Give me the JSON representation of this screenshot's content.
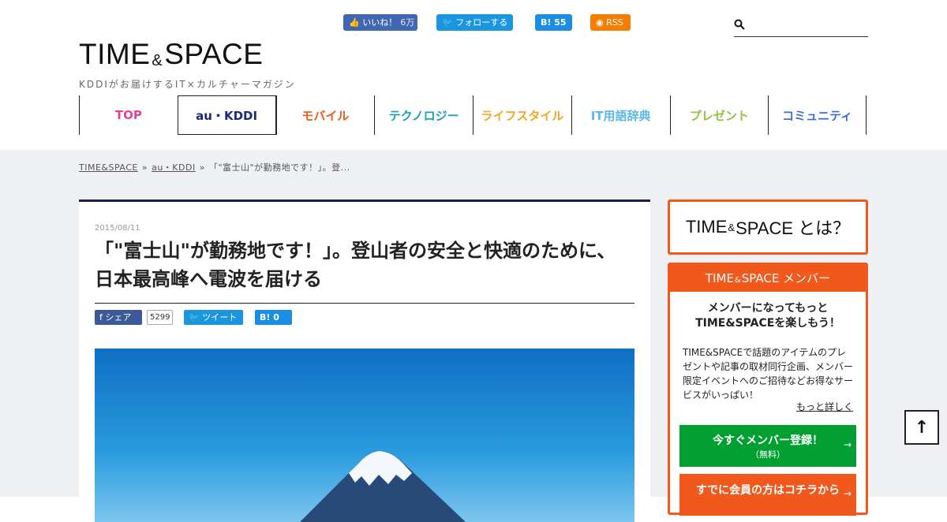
{
  "social": {
    "fb_label": "いいね！",
    "fb_count": "6万",
    "tw_label": "フォローする",
    "hb_label": "B! 55",
    "rss_label": "RSS"
  },
  "logo": {
    "left": "TIME",
    "amp": "&",
    "right": "SPACE",
    "tagline": "KDDIがお届けするIT×カルチャーマガジン"
  },
  "search": {
    "placeholder": ""
  },
  "nav": [
    {
      "label": "TOP",
      "color": "#e0449a"
    },
    {
      "label": "au・KDDI",
      "color": "#1b2a7a"
    },
    {
      "label": "モバイル",
      "color": "#f0581c"
    },
    {
      "label": "テクノロジー",
      "color": "#1ba1b5"
    },
    {
      "label": "ライフスタイル",
      "color": "#f5a623"
    },
    {
      "label": "IT用語辞典",
      "color": "#59b8e8"
    },
    {
      "label": "プレゼント",
      "color": "#8cc63f"
    },
    {
      "label": "コミュニティ",
      "color": "#3a6fd8"
    }
  ],
  "breadcrumb": {
    "home": "TIME&SPACE",
    "category": "au・KDDI",
    "current": "「\"富士山\"が勤務地です！」。登...",
    "sep": "»"
  },
  "article": {
    "date": "2015/08/11",
    "title": "「\"富士山\"が勤務地です！」。登山者の安全と快適のために、日本最高峰へ電波を届ける",
    "share_fb": "シェア",
    "share_fb_count": "5299",
    "share_tw": "ツイート",
    "share_hb": "B!  0"
  },
  "sidebar": {
    "about_left": "TIME",
    "about_amp": "&",
    "about_right": "SPACE とは？",
    "member_head_left": "TIME",
    "member_head_amp": "&",
    "member_head_right": "SPACE メンバー",
    "member_catch_1": "メンバーになってもっと",
    "member_catch_2": "TIME&SPACEを楽しもう！",
    "member_desc": "TIME&SPACEで話題のアイテムのプレゼントや記事の取材同行企画、メンバー限定イベントへのご招待などお得なサービスがいっぱい！",
    "member_more": "もっと詳しく",
    "register_main": "今すぐメンバー登録！",
    "register_sub": "（無料）",
    "login_main": "すでに会員の方はコチラから",
    "arrow": "→"
  },
  "to_top": "↑",
  "colors": {
    "accent": "#f0581c",
    "green": "#02a033",
    "navy": "#1b1f4a"
  }
}
